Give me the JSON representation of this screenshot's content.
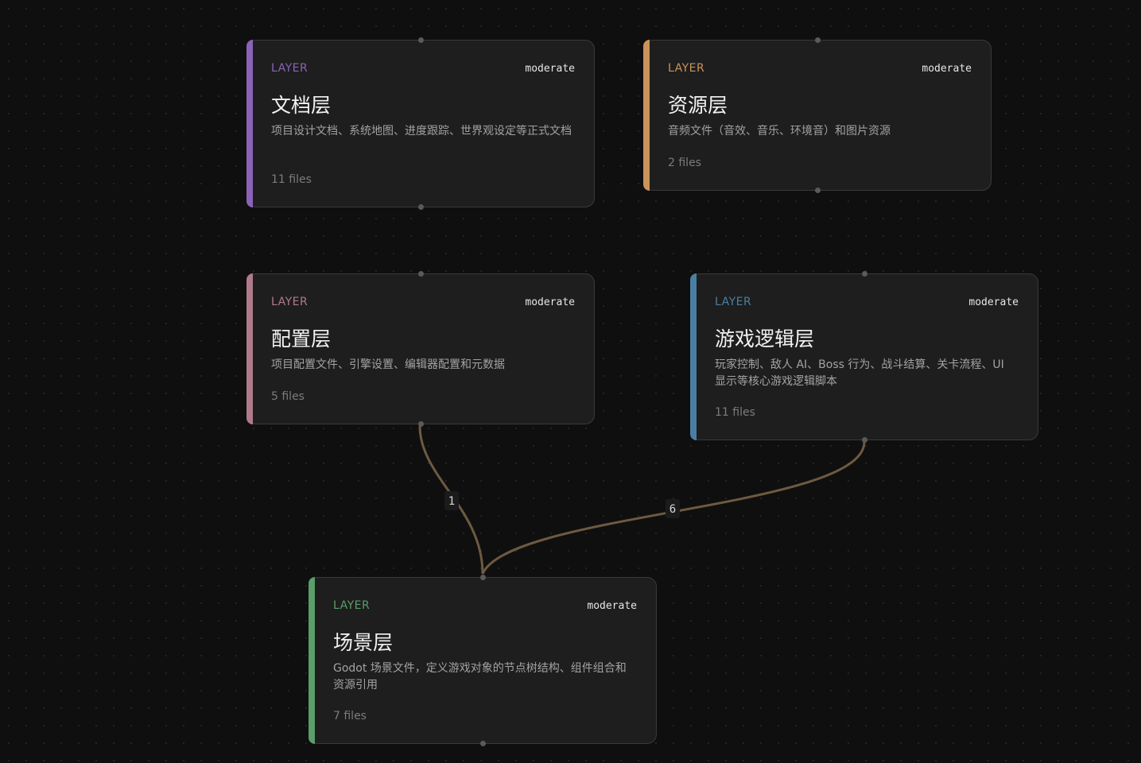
{
  "nodes": {
    "docs": {
      "tag": "LAYER",
      "level": "moderate",
      "title": "文档层",
      "description": "项目设计文档、系统地图、进度跟踪、世界观设定等正式文档",
      "files": "11 files",
      "accent_color": "#8a63b8"
    },
    "res": {
      "tag": "LAYER",
      "level": "moderate",
      "title": "资源层",
      "description": "音频文件（音效、音乐、环境音）和图片资源",
      "files": "2 files",
      "accent_color": "#c9935a"
    },
    "config": {
      "tag": "LAYER",
      "level": "moderate",
      "title": "配置层",
      "description": "项目配置文件、引擎设置、编辑器配置和元数据",
      "files": "5 files",
      "accent_color": "#b07a8a"
    },
    "logic": {
      "tag": "LAYER",
      "level": "moderate",
      "title": "游戏逻辑层",
      "description": "玩家控制、敌人 AI、Boss 行为、战斗结算、关卡流程、UI 显示等核心游戏逻辑脚本",
      "files": "11 files",
      "accent_color": "#4a7fa3"
    },
    "scene": {
      "tag": "LAYER",
      "level": "moderate",
      "title": "场景层",
      "description": "Godot 场景文件，定义游戏对象的节点树结构、组件组合和资源引用",
      "files": "7 files",
      "accent_color": "#5a9e6a"
    }
  },
  "edges": [
    {
      "from": "config",
      "to": "scene",
      "label": "1"
    },
    {
      "from": "logic",
      "to": "scene",
      "label": "6"
    }
  ]
}
